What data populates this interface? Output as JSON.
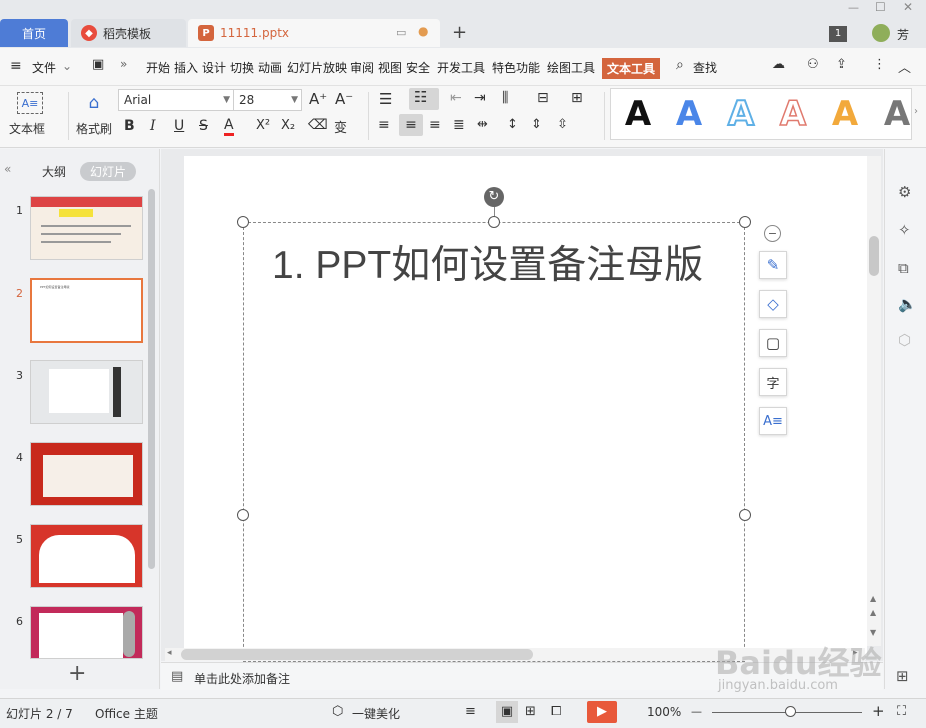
{
  "tabs": {
    "home": "首页",
    "daoke": "稻壳模板",
    "file": "11111.pptx",
    "user": "芳",
    "badge": "1"
  },
  "menubar": {
    "file": "文件",
    "items": [
      "开始",
      "插入",
      "设计",
      "切换",
      "动画",
      "幻灯片放映",
      "审阅",
      "视图",
      "安全",
      "开发工具",
      "特色功能",
      "绘图工具"
    ],
    "active": "文本工具",
    "search": "查找"
  },
  "ribbon": {
    "textbox": "文本框",
    "format_brush": "格式刷",
    "font_name": "Arial",
    "font_size": "28",
    "bold": "B",
    "italic": "I",
    "underline": "U",
    "strike": "S",
    "font_color": "A",
    "superscript": "X²",
    "subscript": "X₂",
    "phonetic": "变",
    "wordart_letter": "A"
  },
  "panel": {
    "outline_tab": "大纲",
    "slides_tab": "幻灯片",
    "thumb_title": "PPT如何设置备注母版",
    "thumbnails": [
      "1",
      "2",
      "3",
      "4",
      "5",
      "6"
    ],
    "add": "+"
  },
  "slide": {
    "title": "1.  PPT如何设置备注母版"
  },
  "notes": {
    "placeholder": "单击此处添加备注"
  },
  "status": {
    "slide_count": "幻灯片 2 / 7",
    "theme": "Office 主题",
    "beautify": "一键美化",
    "zoom": "100%",
    "zoom_minus": "—",
    "zoom_plus": "+"
  },
  "watermark": {
    "text": "Baidu经验",
    "url": "jingyan.baidu.com"
  },
  "colors": {
    "accent_orange": "#d4653d",
    "home_tab": "#4e7cd6",
    "active_tab": "#d4653d",
    "play": "#e8593b"
  }
}
